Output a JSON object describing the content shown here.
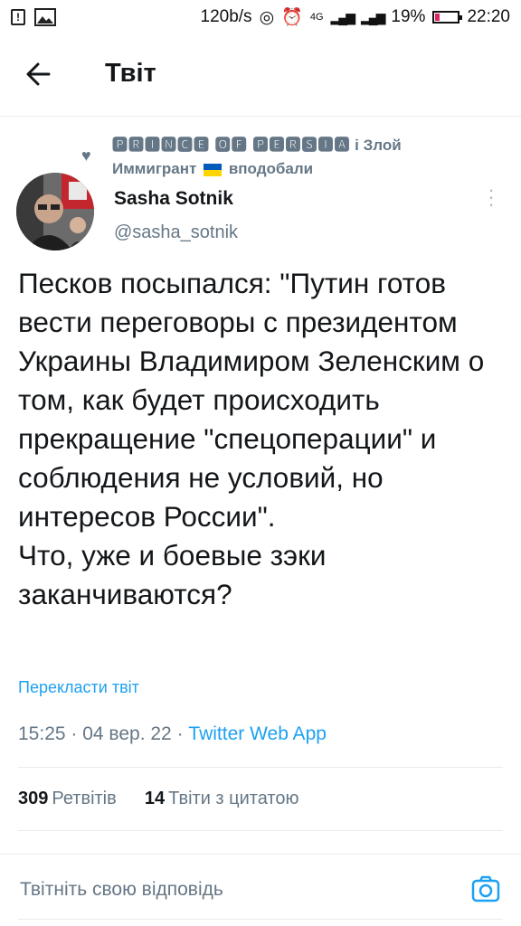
{
  "status_bar": {
    "network_speed": "120b/s",
    "network_type": "4G",
    "battery": "19%",
    "battery_level": 0.19,
    "time": "22:20"
  },
  "header": {
    "title": "Твіт",
    "back_icon": "arrow-left-icon"
  },
  "liked_by": {
    "names_part1": "🅿🆁🅸🅽🅲🅴 🅾🅵 🅿🅴🆁🆂🅸🅰",
    "connector": " і Злой Иммигрант",
    "suffix": "вподобали"
  },
  "author": {
    "name": "Sasha Sotnik",
    "handle": "@sasha_sotnik"
  },
  "tweet": {
    "text": "Песков посыпался: \"Путин готов вести переговоры с президентом Украины Владимиром Зеленским о том, как будет происходить прекращение \"спецоперации\" и соблюдения не условий, но интересов России\".\nЧто, уже и боевые зэки заканчиваются?",
    "translate_label": "Перекласти твіт",
    "time": "15:25",
    "date": "04 вер. 22",
    "source": "Twitter Web App"
  },
  "stats": {
    "retweets_count": "309",
    "retweets_label": "Ретвітів",
    "quotes_count": "14",
    "quotes_label": "Твіти з цитатою"
  },
  "reply": {
    "placeholder": "Твітніть свою відповідь"
  },
  "colors": {
    "accent": "#1da1f2",
    "secondary_text": "#657786"
  }
}
